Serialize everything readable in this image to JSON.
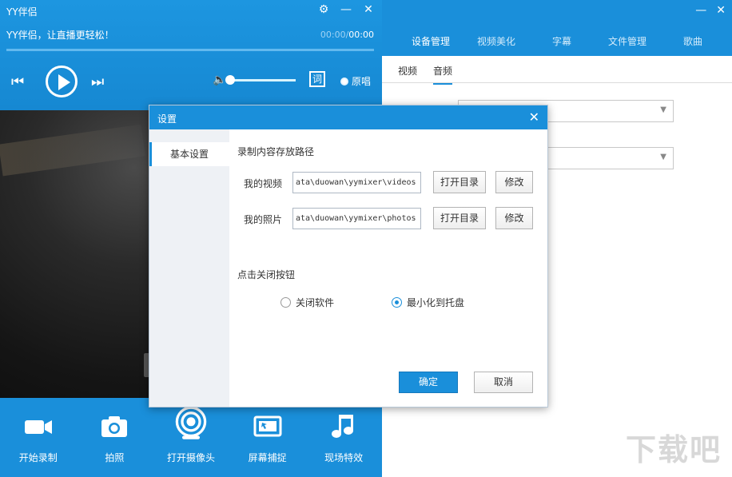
{
  "player": {
    "title": "YY伴侣",
    "slogan": "YY伴侣，让直播更轻松！",
    "time_current": "00:00",
    "time_separator": "/",
    "time_total": "00:00",
    "lyric_label": "词",
    "original_label": "原唱",
    "icons": {
      "settings": "⚙",
      "minimize": "—",
      "close": "✕",
      "prev": "⏮",
      "next": "⏭",
      "volume": "🔈"
    }
  },
  "tools": [
    {
      "label": "开始录制",
      "icon": "video-camera-icon"
    },
    {
      "label": "拍照",
      "icon": "photo-camera-icon"
    },
    {
      "label": "打开摄像头",
      "icon": "webcam-icon"
    },
    {
      "label": "屏幕捕捉",
      "icon": "screen-capture-icon"
    },
    {
      "label": "现场特效",
      "icon": "music-note-icon"
    }
  ],
  "right_panel": {
    "tabs": [
      "设备管理",
      "视频美化",
      "字幕",
      "文件管理",
      "歌曲"
    ],
    "subtabs": [
      "视频",
      "音频"
    ],
    "icons": {
      "minimize": "—",
      "close": "✕"
    }
  },
  "dialog": {
    "title": "设置",
    "close_icon": "✕",
    "side_item": "基本设置",
    "section_path": "录制内容存放路径",
    "video_label": "我的视频",
    "video_path": "ata\\duowan\\yymixer\\videos",
    "photo_label": "我的照片",
    "photo_path": "ata\\duowan\\yymixer\\photos",
    "open_dir": "打开目录",
    "modify": "修改",
    "section_close": "点击关闭按钮",
    "radio_close": "关闭软件",
    "radio_minimize": "最小化到托盘",
    "ok": "确定",
    "cancel": "取消"
  },
  "watermark": "下载吧",
  "colors": {
    "accent": "#1a8fda"
  }
}
